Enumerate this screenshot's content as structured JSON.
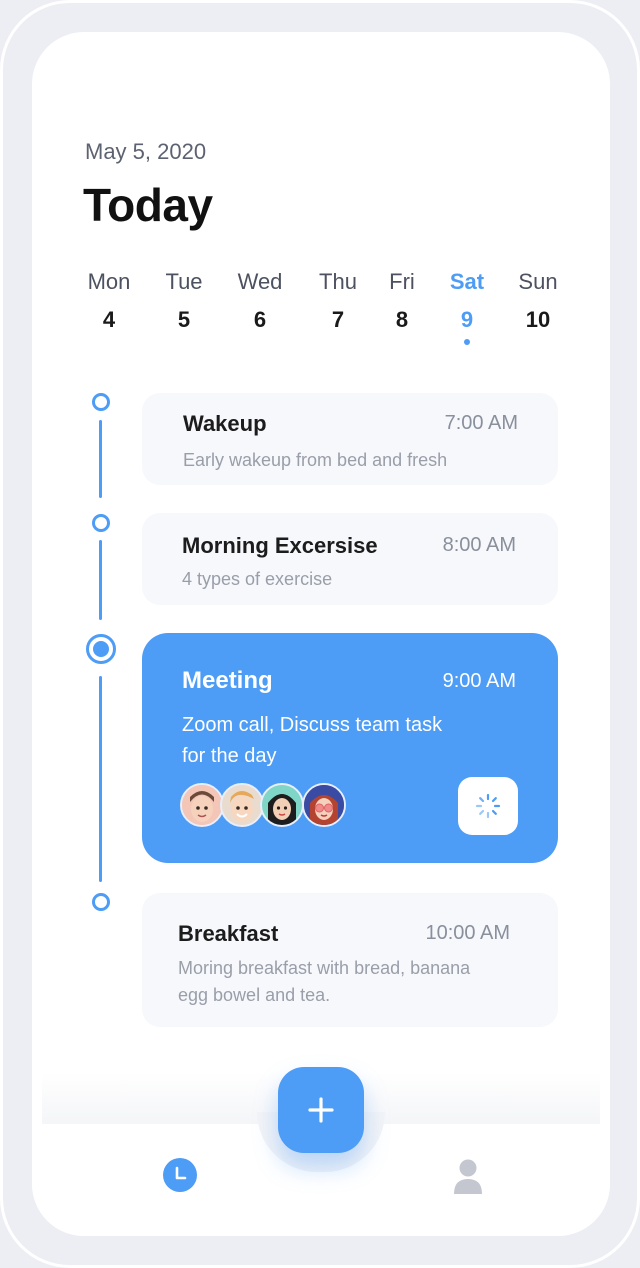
{
  "header": {
    "date": "May 5, 2020",
    "title": "Today"
  },
  "week": [
    {
      "name": "Mon",
      "num": "4",
      "active": false
    },
    {
      "name": "Tue",
      "num": "5",
      "active": false
    },
    {
      "name": "Wed",
      "num": "6",
      "active": false
    },
    {
      "name": "Thu",
      "num": "7",
      "active": false
    },
    {
      "name": "Fri",
      "num": "8",
      "active": false
    },
    {
      "name": "Sat",
      "num": "9",
      "active": true
    },
    {
      "name": "Sun",
      "num": "10",
      "active": false
    }
  ],
  "events": [
    {
      "title": "Wakeup",
      "time": "7:00 AM",
      "desc": "Early wakeup from bed and fresh"
    },
    {
      "title": "Morning Excersise",
      "time": "8:00 AM",
      "desc": "4 types of exercise"
    },
    {
      "title": "Meeting",
      "time": "9:00 AM",
      "desc_line1": "Zoom call, Discuss team task",
      "desc_line2": "for the day",
      "attendee_count": 4
    },
    {
      "title": "Breakfast",
      "time": "10:00 AM",
      "desc_line1": "Moring breakfast with bread, banana",
      "desc_line2": "egg bowel and tea."
    }
  ],
  "nav": {
    "fab_icon": "plus-icon",
    "left_icon": "clock-icon",
    "right_icon": "profile-icon"
  },
  "colors": {
    "accent": "#4d9cf5",
    "background": "#eceef3",
    "card": "#f6f8fc"
  }
}
